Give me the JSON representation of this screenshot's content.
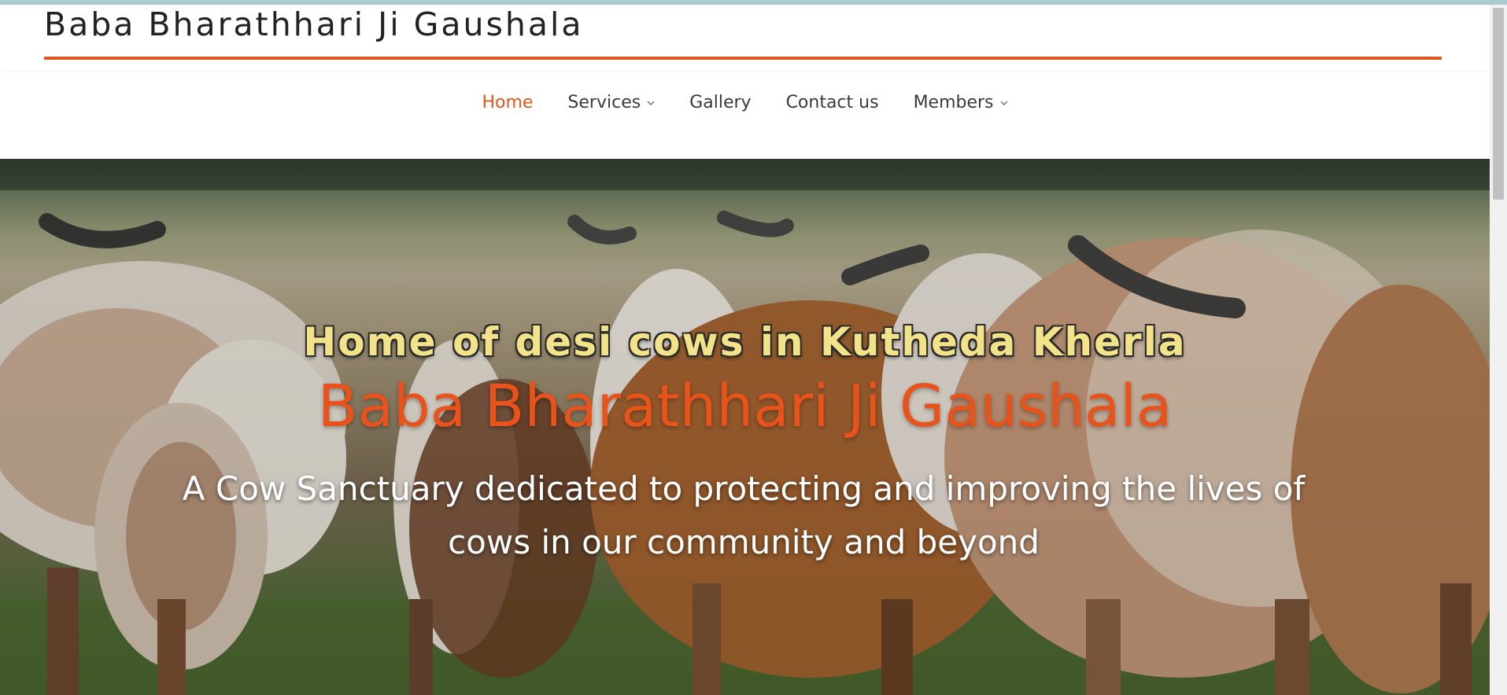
{
  "site": {
    "title": "Baba Bharathhari Ji Gaushala"
  },
  "nav": {
    "items": [
      {
        "label": "Home",
        "active": true,
        "has_dropdown": false
      },
      {
        "label": "Services",
        "active": false,
        "has_dropdown": true
      },
      {
        "label": "Gallery",
        "active": false,
        "has_dropdown": false
      },
      {
        "label": "Contact us",
        "active": false,
        "has_dropdown": false
      },
      {
        "label": "Members",
        "active": false,
        "has_dropdown": true
      }
    ]
  },
  "hero": {
    "kicker": "Home of desi cows in Kutheda Kherla",
    "title": "Baba Bharathhari Ji Gaushala",
    "subtitle": "A Cow Sanctuary dedicated to protecting and improving the lives of cows in our community and beyond",
    "image_subject": "herd of Gir cows in a field"
  },
  "icons": {
    "dropdown": "chevron-down-icon"
  },
  "colors": {
    "accent": "#e2561e",
    "kicker": "#f2e38a",
    "hero_title": "#e8531c",
    "nav_text": "#3a3a3a"
  }
}
